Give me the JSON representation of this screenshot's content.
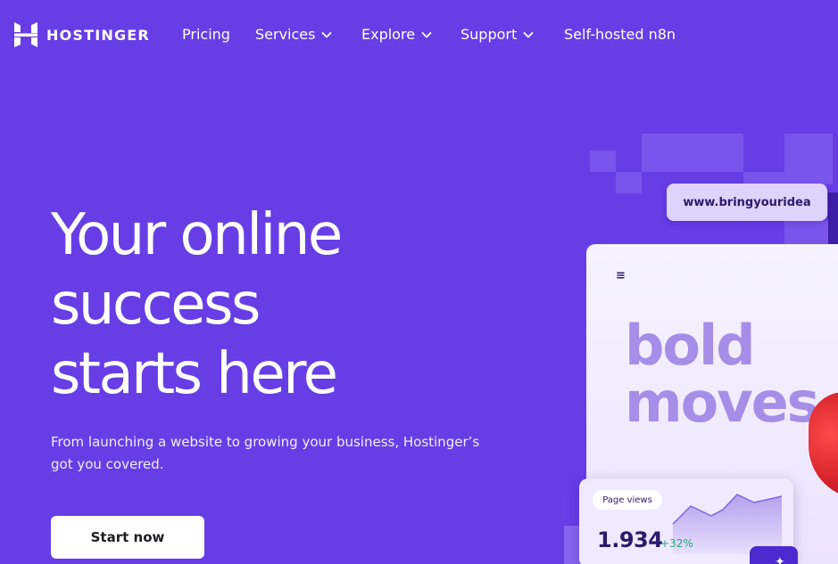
{
  "nav": {
    "logo_text": "HOSTINGER",
    "items": [
      {
        "label": "Pricing",
        "has_dropdown": false
      },
      {
        "label": "Services",
        "has_dropdown": true
      },
      {
        "label": "Explore",
        "has_dropdown": true
      },
      {
        "label": "Support",
        "has_dropdown": true
      },
      {
        "label": "Self-hosted n8n",
        "has_dropdown": false
      }
    ],
    "icons": [
      "hostinger-logo-icon",
      "chevron-down-icon"
    ]
  },
  "hero": {
    "title_lines": [
      "Your online",
      "success",
      "starts here"
    ],
    "subtitle": "From launching a website to growing your business, Hostinger’s got you covered.",
    "cta_label": "Start now"
  },
  "illustration": {
    "url_text": "www.bringyouridea",
    "menu_glyph": "≡",
    "headline_lines": [
      "bold",
      "moves"
    ],
    "stats": {
      "badge": "Page views",
      "value": "1.934",
      "change": "+32%"
    },
    "sparkle_glyph": "✦"
  },
  "colors": {
    "background": "#673de6",
    "button_bg": "#ffffff",
    "button_text": "#1d1e20",
    "headline_purple": "#a48ee8",
    "positive_green": "#2aa876"
  }
}
